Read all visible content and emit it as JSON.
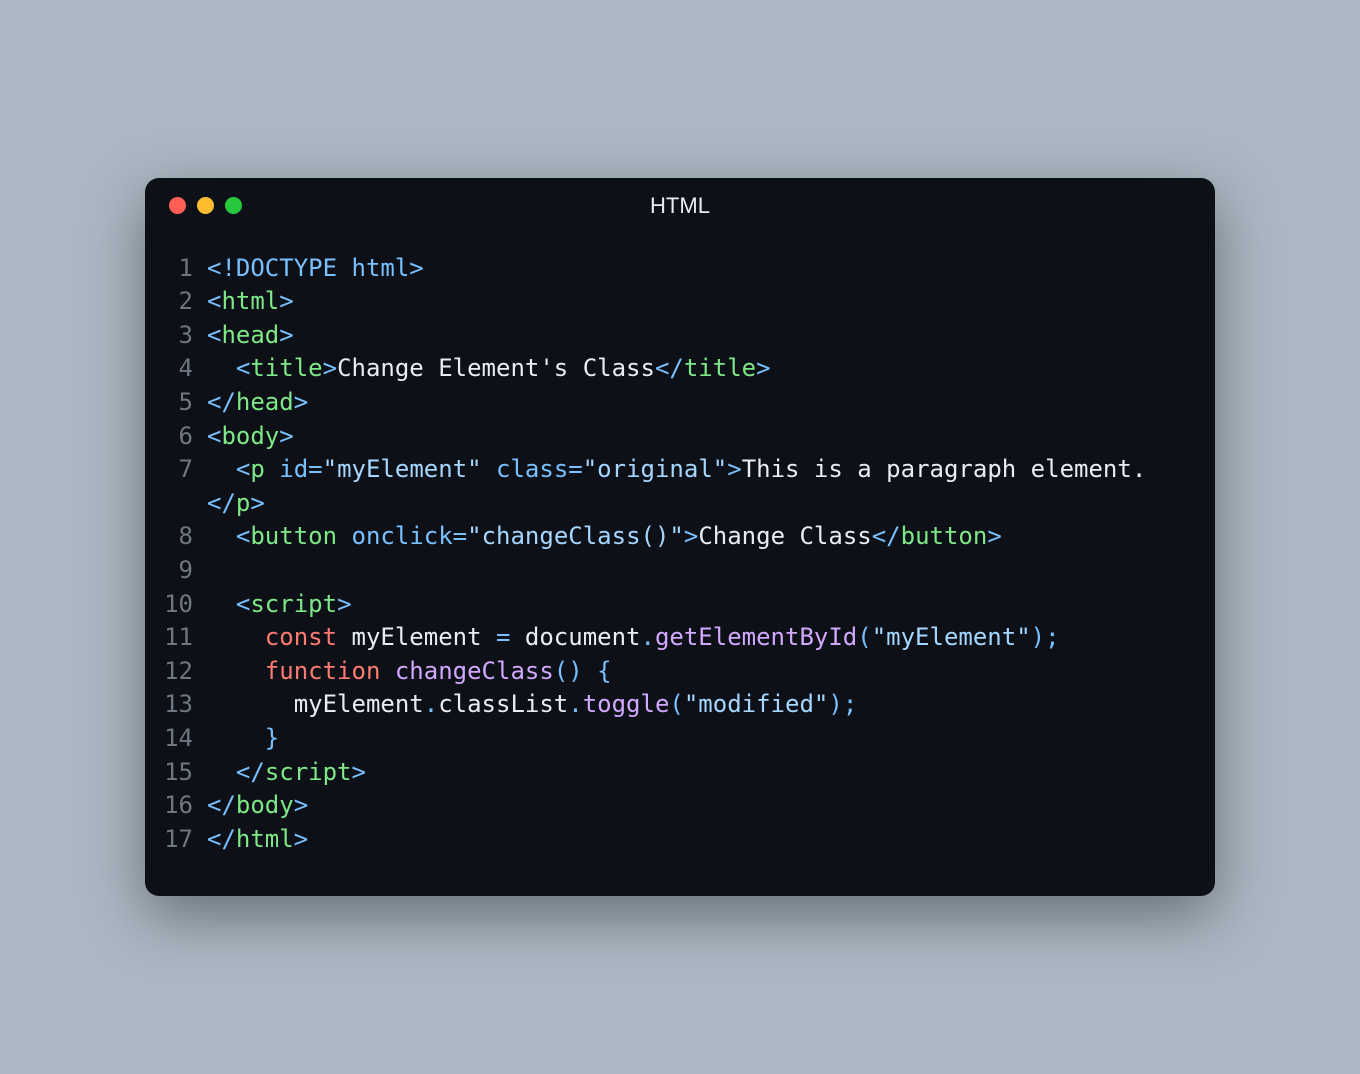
{
  "window": {
    "title": "HTML"
  },
  "code": {
    "lines": [
      {
        "n": 1,
        "tokens": [
          [
            "t-punc",
            "<!"
          ],
          [
            "t-doct",
            "DOCTYPE html"
          ],
          [
            "t-punc",
            ">"
          ]
        ]
      },
      {
        "n": 2,
        "tokens": [
          [
            "t-punc",
            "<"
          ],
          [
            "t-tag",
            "html"
          ],
          [
            "t-punc",
            ">"
          ]
        ]
      },
      {
        "n": 3,
        "tokens": [
          [
            "t-punc",
            "<"
          ],
          [
            "t-tag",
            "head"
          ],
          [
            "t-punc",
            ">"
          ]
        ]
      },
      {
        "n": 4,
        "tokens": [
          [
            "t-text",
            "  "
          ],
          [
            "t-punc",
            "<"
          ],
          [
            "t-tag",
            "title"
          ],
          [
            "t-punc",
            ">"
          ],
          [
            "t-text",
            "Change Element's Class"
          ],
          [
            "t-punc",
            "</"
          ],
          [
            "t-tag",
            "title"
          ],
          [
            "t-punc",
            ">"
          ]
        ]
      },
      {
        "n": 5,
        "tokens": [
          [
            "t-punc",
            "</"
          ],
          [
            "t-tag",
            "head"
          ],
          [
            "t-punc",
            ">"
          ]
        ]
      },
      {
        "n": 6,
        "tokens": [
          [
            "t-punc",
            "<"
          ],
          [
            "t-tag",
            "body"
          ],
          [
            "t-punc",
            ">"
          ]
        ]
      },
      {
        "n": 7,
        "tokens": [
          [
            "t-text",
            "  "
          ],
          [
            "t-punc",
            "<"
          ],
          [
            "t-tag",
            "p"
          ],
          [
            "t-text",
            " "
          ],
          [
            "t-attr",
            "id"
          ],
          [
            "t-punc",
            "="
          ],
          [
            "t-str",
            "\"myElement\""
          ],
          [
            "t-text",
            " "
          ],
          [
            "t-attr",
            "class"
          ],
          [
            "t-punc",
            "="
          ],
          [
            "t-str",
            "\"original\""
          ],
          [
            "t-punc",
            ">"
          ],
          [
            "t-text",
            "This is a paragraph element."
          ],
          [
            "t-punc",
            "</"
          ],
          [
            "t-tag",
            "p"
          ],
          [
            "t-punc",
            ">"
          ]
        ]
      },
      {
        "n": 8,
        "tokens": [
          [
            "t-text",
            "  "
          ],
          [
            "t-punc",
            "<"
          ],
          [
            "t-tag",
            "button"
          ],
          [
            "t-text",
            " "
          ],
          [
            "t-attr",
            "onclick"
          ],
          [
            "t-punc",
            "="
          ],
          [
            "t-str",
            "\"changeClass()\""
          ],
          [
            "t-punc",
            ">"
          ],
          [
            "t-text",
            "Change Class"
          ],
          [
            "t-punc",
            "</"
          ],
          [
            "t-tag",
            "button"
          ],
          [
            "t-punc",
            ">"
          ]
        ]
      },
      {
        "n": 9,
        "tokens": [
          [
            "t-text",
            ""
          ]
        ]
      },
      {
        "n": 10,
        "tokens": [
          [
            "t-text",
            "  "
          ],
          [
            "t-punc",
            "<"
          ],
          [
            "t-tag",
            "script"
          ],
          [
            "t-punc",
            ">"
          ]
        ]
      },
      {
        "n": 11,
        "tokens": [
          [
            "t-text",
            "    "
          ],
          [
            "t-kw",
            "const"
          ],
          [
            "t-text",
            " "
          ],
          [
            "t-var",
            "myElement"
          ],
          [
            "t-text",
            " "
          ],
          [
            "t-op",
            "="
          ],
          [
            "t-text",
            " "
          ],
          [
            "t-var",
            "document"
          ],
          [
            "t-punc",
            "."
          ],
          [
            "t-fn",
            "getElementById"
          ],
          [
            "t-punc",
            "("
          ],
          [
            "t-str",
            "\"myElement\""
          ],
          [
            "t-punc",
            ")"
          ],
          [
            "t-punc",
            ";"
          ]
        ]
      },
      {
        "n": 12,
        "tokens": [
          [
            "t-text",
            "    "
          ],
          [
            "t-kw",
            "function"
          ],
          [
            "t-text",
            " "
          ],
          [
            "t-fn",
            "changeClass"
          ],
          [
            "t-punc",
            "("
          ],
          [
            "t-punc",
            ")"
          ],
          [
            "t-text",
            " "
          ],
          [
            "t-punc",
            "{"
          ]
        ]
      },
      {
        "n": 13,
        "tokens": [
          [
            "t-text",
            "      "
          ],
          [
            "t-var",
            "myElement"
          ],
          [
            "t-punc",
            "."
          ],
          [
            "t-var",
            "classList"
          ],
          [
            "t-punc",
            "."
          ],
          [
            "t-fn",
            "toggle"
          ],
          [
            "t-punc",
            "("
          ],
          [
            "t-str",
            "\"modified\""
          ],
          [
            "t-punc",
            ")"
          ],
          [
            "t-punc",
            ";"
          ]
        ]
      },
      {
        "n": 14,
        "tokens": [
          [
            "t-text",
            "    "
          ],
          [
            "t-punc",
            "}"
          ]
        ]
      },
      {
        "n": 15,
        "tokens": [
          [
            "t-text",
            "  "
          ],
          [
            "t-punc",
            "</"
          ],
          [
            "t-tag",
            "script"
          ],
          [
            "t-punc",
            ">"
          ]
        ]
      },
      {
        "n": 16,
        "tokens": [
          [
            "t-punc",
            "</"
          ],
          [
            "t-tag",
            "body"
          ],
          [
            "t-punc",
            ">"
          ]
        ]
      },
      {
        "n": 17,
        "tokens": [
          [
            "t-punc",
            "</"
          ],
          [
            "t-tag",
            "html"
          ],
          [
            "t-punc",
            ">"
          ]
        ]
      }
    ]
  }
}
